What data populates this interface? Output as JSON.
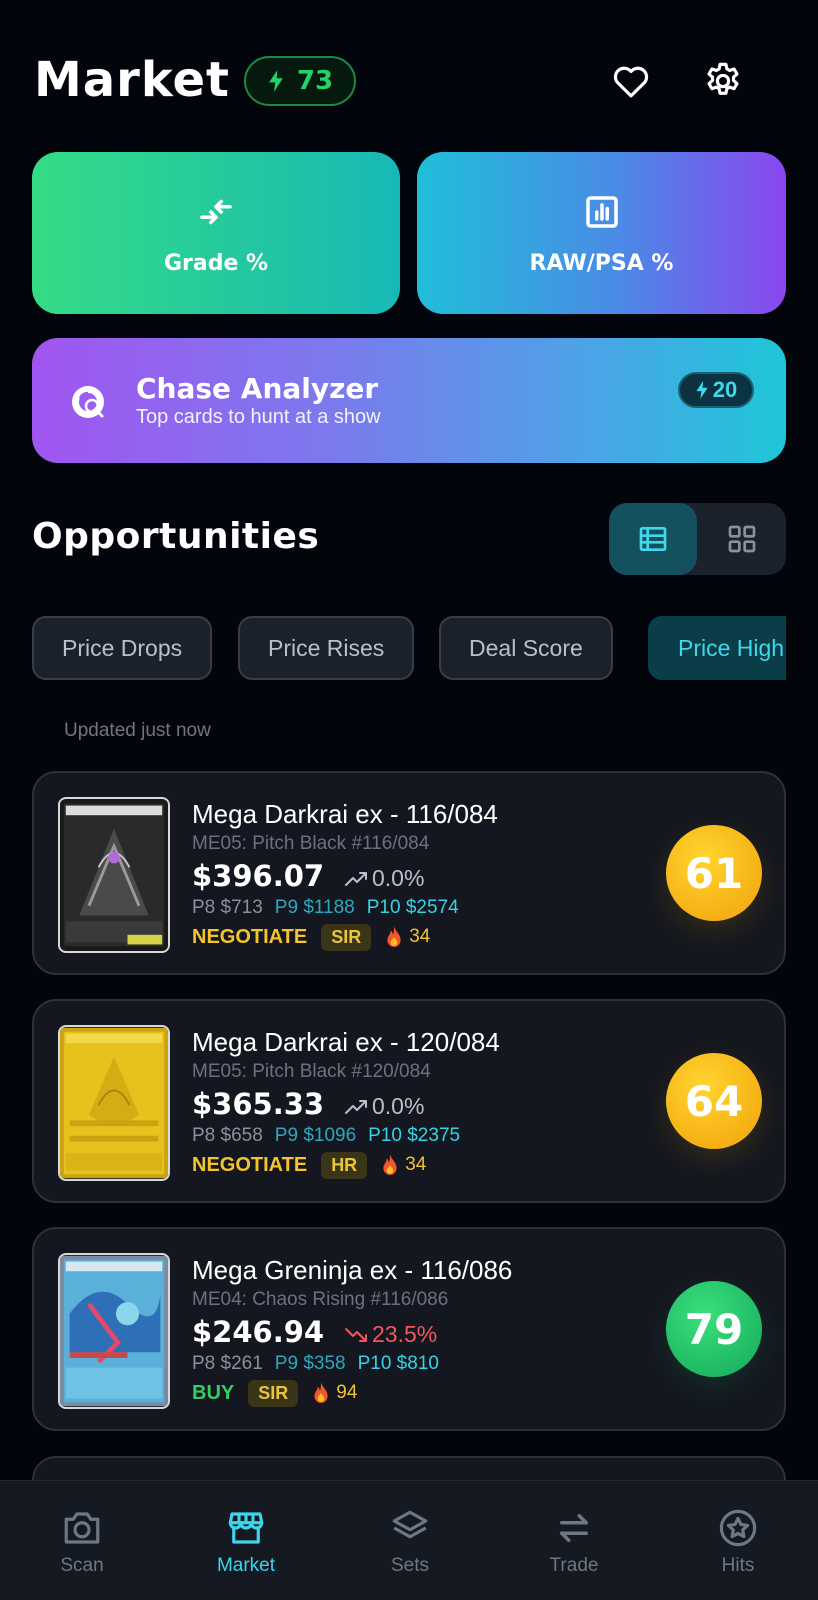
{
  "header": {
    "title": "Market",
    "energy": "73"
  },
  "features": {
    "grade": "Grade %",
    "raw_psa": "RAW/PSA %"
  },
  "chase": {
    "title": "Chase Analyzer",
    "subtitle": "Top cards to hunt at a show",
    "cost": "20"
  },
  "opportunities": {
    "title": "Opportunities",
    "filters": [
      "Price Drops",
      "Price Rises",
      "Deal Score",
      "Price High"
    ],
    "active_filter_index": 3,
    "updated": "Updated just now"
  },
  "cards": [
    {
      "name": "Mega Darkrai ex - 116/084",
      "set": "ME05: Pitch Black #116/084",
      "price": "$396.07",
      "change": "0.0%",
      "change_dir": "flat",
      "p8": "P8 $713",
      "p9": "P9 $1188",
      "p10": "P10 $2574",
      "action": "NEGOTIATE",
      "rarity": "SIR",
      "heat": "34",
      "score": "61",
      "score_color": "#f5b318"
    },
    {
      "name": "Mega Darkrai ex - 120/084",
      "set": "ME05: Pitch Black #120/084",
      "price": "$365.33",
      "change": "0.0%",
      "change_dir": "flat",
      "p8": "P8 $658",
      "p9": "P9 $1096",
      "p10": "P10 $2375",
      "action": "NEGOTIATE",
      "rarity": "HR",
      "heat": "34",
      "score": "64",
      "score_color": "#f5b318"
    },
    {
      "name": "Mega Greninja ex - 116/086",
      "set": "ME04: Chaos Rising #116/086",
      "price": "$246.94",
      "change": "23.5%",
      "change_dir": "down",
      "p8": "P8 $261",
      "p9": "P9 $358",
      "p10": "P10 $810",
      "action": "BUY",
      "rarity": "SIR",
      "heat": "94",
      "score": "79",
      "score_color": "#22c66b"
    }
  ],
  "nav": {
    "items": [
      "Scan",
      "Market",
      "Sets",
      "Trade",
      "Hits"
    ],
    "active": "Market"
  },
  "colors": {
    "accent": "#3ed9ea",
    "background": "#03050d",
    "energy_green": "#22d36a",
    "negotiate": "#f5c32c",
    "buy": "#34cc63",
    "down": "#f0575e"
  }
}
